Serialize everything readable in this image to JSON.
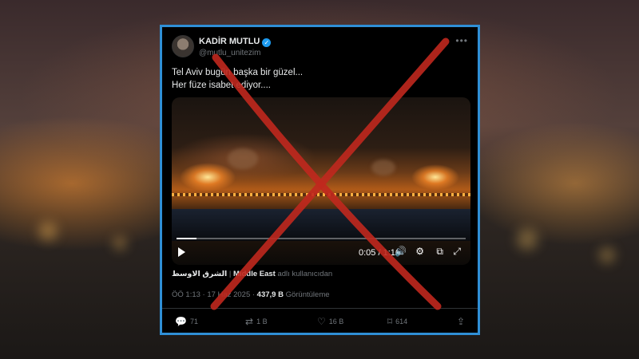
{
  "tweet": {
    "display_name": "KADİR MUTLU",
    "handle": "@mutlu_unitezim",
    "text_line1": "Tel Aviv bugün başka bir güzel...",
    "text_line2": "Her füze isabet ediyor....",
    "more_icon": "more-dots-icon"
  },
  "video": {
    "time": "0:05 / 1:16",
    "progress": 0.07
  },
  "source": {
    "arabic": "الشرق الاوسط",
    "separator": " | ",
    "bold": "Middle East",
    "suffix": " adlı kullanıcıdan"
  },
  "meta": {
    "datetime": "ÖÖ 1:13 · 17 Haz 2025 · ",
    "views": "437,9 B",
    "views_label": " Görüntüleme"
  },
  "actions": {
    "replies": "71",
    "reposts": "1 B",
    "likes": "16 B",
    "bookmarks": "614"
  },
  "colors": {
    "frame": "#2f8fd6",
    "cross": "#c0281e",
    "verified": "#1d9bf0"
  }
}
